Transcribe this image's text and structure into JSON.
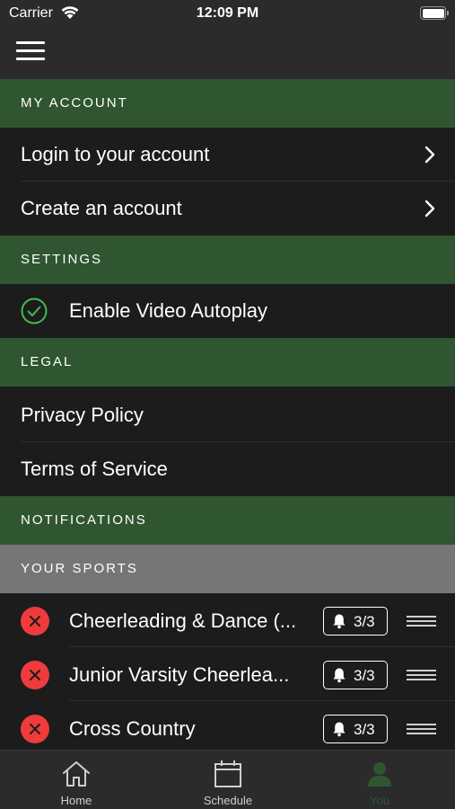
{
  "status_bar": {
    "carrier": "Carrier",
    "time": "12:09 PM"
  },
  "sections": {
    "my_account": "MY ACCOUNT",
    "settings": "SETTINGS",
    "legal": "LEGAL",
    "notifications": "NOTIFICATIONS",
    "your_sports": "YOUR SPORTS"
  },
  "account": {
    "login": "Login to your account",
    "create": "Create an account"
  },
  "settings": {
    "autoplay": "Enable Video Autoplay",
    "autoplay_enabled": true
  },
  "legal": {
    "privacy": "Privacy Policy",
    "terms": "Terms of Service"
  },
  "sports": [
    {
      "name": "Cheerleading & Dance (...",
      "notifications": "3/3"
    },
    {
      "name": "Junior Varsity Cheerlea...",
      "notifications": "3/3"
    },
    {
      "name": "Cross Country",
      "notifications": "3/3"
    }
  ],
  "tabs": [
    {
      "label": "Home",
      "icon": "home-icon"
    },
    {
      "label": "Schedule",
      "icon": "calendar-icon"
    },
    {
      "label": "You",
      "icon": "person-icon",
      "active": true
    }
  ],
  "colors": {
    "section_green": "#2f5531",
    "section_gray": "#767676",
    "remove_red": "#ef3b3b",
    "check_green": "#3fbf4f"
  }
}
